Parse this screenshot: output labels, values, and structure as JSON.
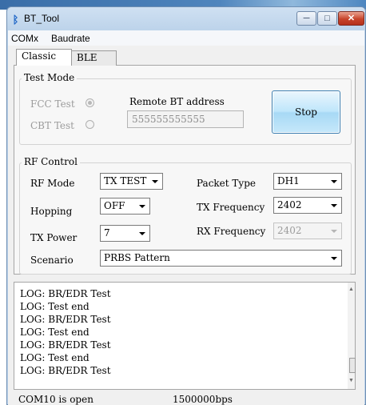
{
  "window": {
    "title": "BT_Tool",
    "icon": "bluetooth-icon",
    "minimize": "─",
    "maximize": "□",
    "close": "✕"
  },
  "menu": {
    "items": [
      "COMx",
      "Baudrate"
    ]
  },
  "tabs": {
    "classic": "Classic",
    "ble": "BLE"
  },
  "test_mode": {
    "legend": "Test Mode",
    "fcc_label": "FCC Test",
    "cbt_label": "CBT Test",
    "fcc_selected": true,
    "remote_label": "Remote BT address",
    "remote_address": "555555555555",
    "stop_label": "Stop"
  },
  "rf_control": {
    "legend": "RF Control",
    "rf_mode": {
      "label": "RF Mode",
      "value": "TX TEST"
    },
    "hopping": {
      "label": "Hopping",
      "value": "OFF"
    },
    "tx_power": {
      "label": "TX Power",
      "value": "7"
    },
    "scenario": {
      "label": "Scenario",
      "value": "PRBS Pattern"
    },
    "packet_type": {
      "label": "Packet Type",
      "value": "DH1"
    },
    "tx_frequency": {
      "label": "TX Frequency",
      "value": "2402"
    },
    "rx_frequency": {
      "label": "RX Frequency",
      "value": "2402"
    }
  },
  "log": {
    "lines": [
      "LOG: BR/EDR Test",
      "LOG: Test end",
      "LOG: BR/EDR Test",
      "LOG: Test end",
      "LOG: BR/EDR Test",
      "LOG: Test end",
      "LOG: BR/EDR Test"
    ]
  },
  "status": {
    "port": "COM10 is open",
    "baud": "1500000bps"
  },
  "colors": {
    "accent": "#3c7fb1",
    "close_red": "#c7442b",
    "disabled_text": "#9b9b9b"
  }
}
